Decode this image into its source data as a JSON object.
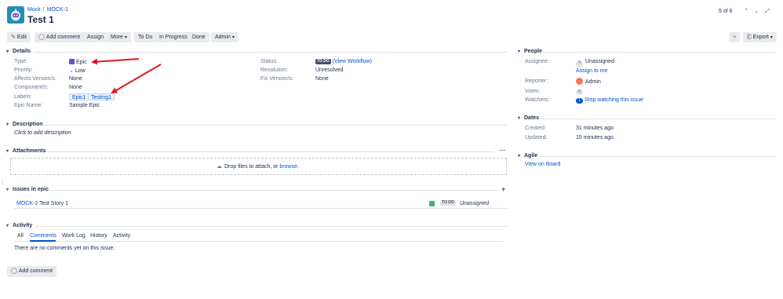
{
  "breadcrumb": {
    "project": "Mock",
    "issue_key": "MOCK-1"
  },
  "issue": {
    "title": "Test 1"
  },
  "pager": {
    "text": "5 of 6",
    "prev_icon": "chevron-left-icon",
    "next_icon": "chevron-down-icon",
    "expand_icon": "expand-icon"
  },
  "toolbar": {
    "edit": "Edit",
    "add_comment": "Add comment",
    "assign": "Assign",
    "more": "More",
    "to_do": "To Do",
    "in_progress": "In Progress",
    "done": "Done",
    "admin": "Admin",
    "export": "Export"
  },
  "details": {
    "heading": "Details",
    "type_label": "Type:",
    "type_value": "Epic",
    "priority_label": "Priority:",
    "priority_value": "Low",
    "affects_label": "Affects Version/s:",
    "affects_value": "None",
    "components_label": "Component/s:",
    "components_value": "None",
    "labels_label": "Labels:",
    "labels": [
      "Epic1",
      "Testing1"
    ],
    "epic_name_label": "Epic Name:",
    "epic_name_value": "Sample Epic",
    "status_label": "Status:",
    "status_lozenge": "TO DO",
    "status_link": "(View Workflow)",
    "resolution_label": "Resolution:",
    "resolution_value": "Unresolved",
    "fix_label": "Fix Version/s:",
    "fix_value": "None"
  },
  "description": {
    "heading": "Description",
    "placeholder": "Click to add description"
  },
  "attachments": {
    "heading": "Attachments",
    "drop_text": "Drop files to attach, or ",
    "browse": "browse."
  },
  "issues_in_epic": {
    "heading": "Issues in epic",
    "rows": [
      {
        "key": "MOCK-2",
        "summary": "Test Story 1",
        "status": "TO DO",
        "assignee": "Unassigned"
      }
    ]
  },
  "activity": {
    "heading": "Activity",
    "tabs": [
      "All",
      "Comments",
      "Work Log",
      "History",
      "Activity"
    ],
    "active_tab": "Comments",
    "empty": "There are no comments yet on this issue.",
    "add_comment": "Add comment"
  },
  "people": {
    "heading": "People",
    "assignee_label": "Assignee:",
    "assignee_value": "Unassigned",
    "assign_to_me": "Assign to me",
    "reporter_label": "Reporter:",
    "reporter_value": "Admin",
    "votes_label": "Votes:",
    "votes_value": "0",
    "watchers_label": "Watchers:",
    "watchers_value": "1",
    "stop_watching": "Stop watching this issue"
  },
  "dates": {
    "heading": "Dates",
    "created_label": "Created:",
    "created_value": "31 minutes ago",
    "updated_label": "Updated:",
    "updated_value": "15 minutes ago"
  },
  "agile": {
    "heading": "Agile",
    "view_on_board": "View on Board"
  },
  "colors": {
    "annotation_arrow": "#e0191f",
    "link": "#0052cc",
    "epic": "#6554c0"
  }
}
